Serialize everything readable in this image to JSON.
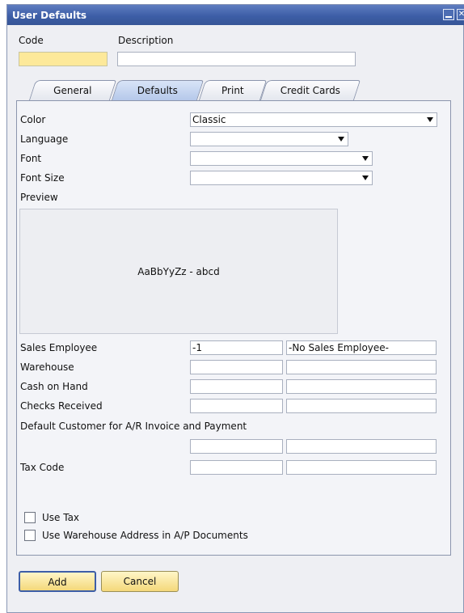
{
  "window": {
    "title": "User Defaults"
  },
  "header": {
    "code_label": "Code",
    "code_value": "",
    "description_label": "Description",
    "description_value": ""
  },
  "tabs": [
    {
      "label": "General",
      "active": false
    },
    {
      "label": "Defaults",
      "active": true
    },
    {
      "label": "Print",
      "active": false
    },
    {
      "label": "Credit Cards",
      "active": false
    }
  ],
  "defaults": {
    "color_label": "Color",
    "color_value": "Classic",
    "language_label": "Language",
    "language_value": "",
    "font_label": "Font",
    "font_value": "",
    "font_size_label": "Font Size",
    "font_size_value": "",
    "preview_label": "Preview",
    "preview_sample": "AaBbYyZz - abcd",
    "sales_employee_label": "Sales Employee",
    "sales_employee_code": "-1",
    "sales_employee_name": "-No Sales Employee-",
    "warehouse_label": "Warehouse",
    "cash_on_hand_label": "Cash on Hand",
    "checks_received_label": "Checks Received",
    "default_customer_label": "Default Customer for A/R Invoice and Payment",
    "tax_code_label": "Tax Code",
    "use_tax_label": "Use Tax",
    "use_tax_checked": false,
    "use_wh_address_label": "Use Warehouse Address in A/P Documents",
    "use_wh_address_checked": false
  },
  "buttons": {
    "add": "Add",
    "cancel": "Cancel"
  },
  "colors": {
    "titlebar": "#3d5ea7",
    "code_field": "#fde99a",
    "button": "#f4d87a"
  }
}
